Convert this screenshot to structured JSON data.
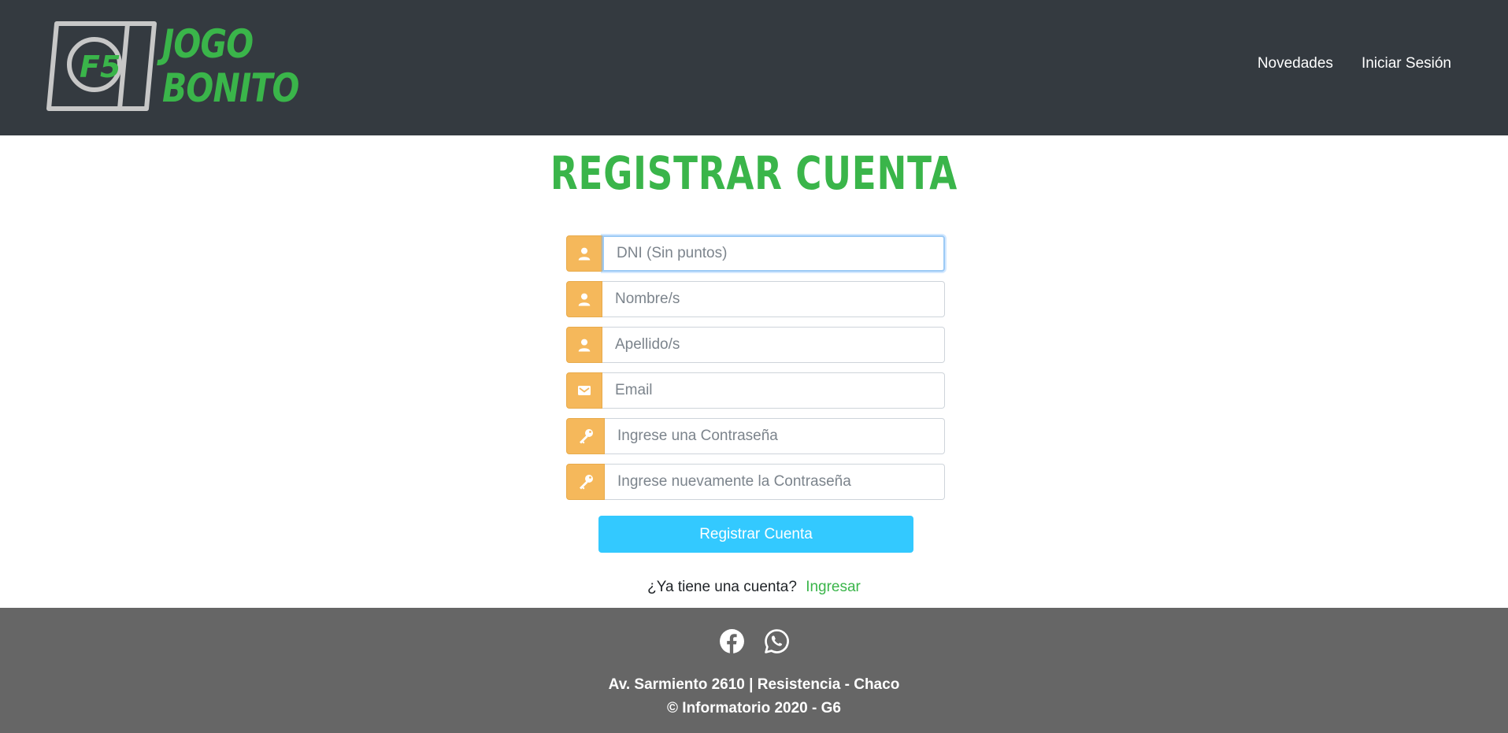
{
  "header": {
    "logo": {
      "badge": "F5",
      "line1": "JOGO",
      "line2": "BONITO"
    },
    "nav": [
      {
        "label": "Novedades"
      },
      {
        "label": "Iniciar Sesión"
      }
    ]
  },
  "main": {
    "title": "REGISTRAR CUENTA",
    "fields": [
      {
        "icon": "user-icon",
        "placeholder": "DNI (Sin puntos)",
        "value": ""
      },
      {
        "icon": "user-icon",
        "placeholder": "Nombre/s",
        "value": ""
      },
      {
        "icon": "user-icon",
        "placeholder": "Apellido/s",
        "value": ""
      },
      {
        "icon": "envelope-icon",
        "placeholder": "Email",
        "value": ""
      },
      {
        "icon": "key-icon",
        "placeholder": "Ingrese una Contraseña",
        "value": ""
      },
      {
        "icon": "key-icon",
        "placeholder": "Ingrese nuevamente la Contraseña",
        "value": ""
      }
    ],
    "submit_label": "Registrar Cuenta",
    "login_prompt": "¿Ya tiene una cuenta?",
    "login_link": "Ingresar"
  },
  "footer": {
    "social": [
      {
        "icon": "facebook-icon"
      },
      {
        "icon": "whatsapp-icon"
      }
    ],
    "address": "Av. Sarmiento 2610 | Resistencia - Chaco",
    "copyright": "© Informatorio 2020 - G6"
  },
  "colors": {
    "header_bg": "#343a40",
    "brand_green": "#3ab54a",
    "addon_orange": "#f5b85b",
    "button_blue": "#33c9ff",
    "footer_bg": "#666666"
  }
}
